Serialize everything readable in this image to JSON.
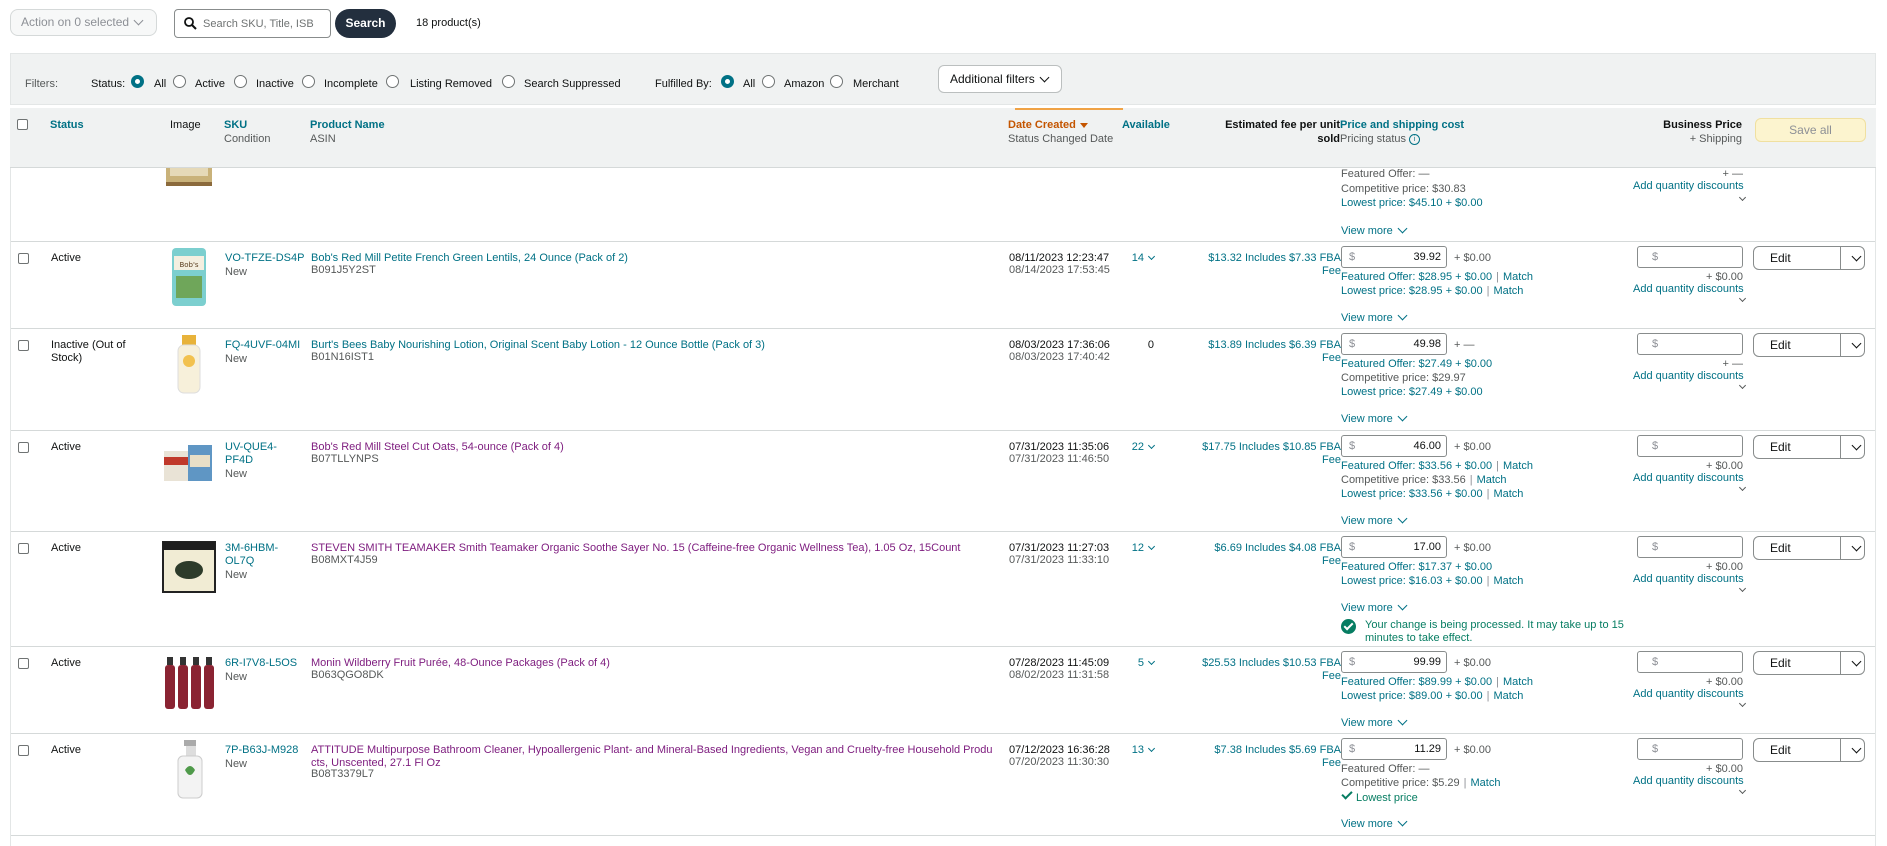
{
  "topbar": {
    "action_label": "Action on 0 selected",
    "search_placeholder": "Search SKU, Title, ISB",
    "search_button": "Search",
    "product_count": "18 product(s)"
  },
  "filters": {
    "label": "Filters:",
    "status_label": "Status:",
    "status_options": [
      "All",
      "Active",
      "Inactive",
      "Incomplete",
      "Listing Removed",
      "Search Suppressed"
    ],
    "status_selected": "All",
    "fulfilled_label": "Fulfilled By:",
    "fulfilled_options": [
      "All",
      "Amazon",
      "Merchant"
    ],
    "fulfilled_selected": "All",
    "additional_filters": "Additional filters"
  },
  "columns": {
    "status": "Status",
    "image": "Image",
    "sku": "SKU",
    "sku_sub": "Condition",
    "product_name": "Product Name",
    "product_sub": "ASIN",
    "date_created": "Date Created",
    "date_sub": "Status Changed Date",
    "available": "Available",
    "fee_line1": "Estimated fee per unit",
    "fee_line2": "sold",
    "price": "Price and shipping cost",
    "price_sub": "Pricing status",
    "business": "Business Price",
    "business_sub": "+ Shipping",
    "save_all": "Save all"
  },
  "partial_row": {
    "offer_featured": "Featured Offer: —",
    "competitive": "Competitive price: $30.83",
    "lowest": "Lowest price: $45.10 + $0.00",
    "view_more": "View more",
    "biz_ship": "+ —",
    "qty_discounts": "Add quantity discounts"
  },
  "rows": [
    {
      "status": "Active",
      "sku": "VO-TFZE-DS4P",
      "condition": "New",
      "name": "Bob's Red Mill Petite French Green Lentils, 24 Ounce (Pack of 2)",
      "asin": "B091J5Y2ST",
      "created": "08/11/2023 12:23:47",
      "changed": "08/14/2023 17:53:45",
      "available": "14",
      "fee1": "$13.32 Includes $7.33 FBA",
      "fee2": "Fee",
      "price": "39.92",
      "ship": "+ $0.00",
      "biz_ship": "+ $0.00",
      "qty": "Add quantity discounts",
      "edit": "Edit",
      "view_more": "View more",
      "featured": "Featured Offer: $28.95 + $0.00",
      "featured_match": "Match",
      "competitive": "",
      "lowest": "Lowest price: $28.95 + $0.00",
      "lowest_match": "Match"
    },
    {
      "status": "Inactive (Out of Stock)",
      "sku": "FQ-4UVF-04MI",
      "condition": "New",
      "name": "Burt's Bees Baby Nourishing Lotion, Original Scent Baby Lotion - 12 Ounce Bottle (Pack of 3)",
      "asin": "B01N16IST1",
      "created": "08/03/2023 17:36:06",
      "changed": "08/03/2023 17:40:42",
      "available": "0",
      "fee1": "$13.89 Includes $6.39 FBA",
      "fee2": "Fee",
      "price": "49.98",
      "ship": "+ —",
      "biz_ship": "+ —",
      "qty": "Add quantity discounts",
      "edit": "Edit",
      "view_more": "View more",
      "featured": "Featured Offer: $27.49 + $0.00",
      "featured_match": "",
      "competitive": "Competitive price: $29.97",
      "lowest": "Lowest price: $27.49 + $0.00",
      "lowest_match": ""
    },
    {
      "status": "Active",
      "sku": "UV-QUE4-PF4D",
      "condition": "New",
      "name": "Bob's Red Mill Steel Cut Oats, 54-ounce (Pack of 4)",
      "asin": "B07TLLYNPS",
      "created": "07/31/2023 11:35:06",
      "changed": "07/31/2023 11:46:50",
      "available": "22",
      "fee1": "$17.75 Includes $10.85 FBA",
      "fee2": "Fee",
      "price": "46.00",
      "ship": "+ $0.00",
      "biz_ship": "+ $0.00",
      "qty": "Add quantity discounts",
      "edit": "Edit",
      "view_more": "View more",
      "featured": "Featured Offer: $33.56 + $0.00",
      "featured_match": "Match",
      "competitive": "Competitive price: $33.56",
      "competitive_match": "Match",
      "lowest": "Lowest price: $33.56 + $0.00",
      "lowest_match": "Match"
    },
    {
      "status": "Active",
      "sku": "3M-6HBM-OL7Q",
      "condition": "New",
      "name": "STEVEN SMITH TEAMAKER Smith Teamaker Organic Soothe Sayer No. 15 (Caffeine-free Organic Wellness Tea), 1.05 Oz, 15Count",
      "asin": "B08MXT4J59",
      "created": "07/31/2023 11:27:03",
      "changed": "07/31/2023 11:33:10",
      "available": "12",
      "fee1": "$6.69 Includes $4.08 FBA",
      "fee2": "Fee",
      "price": "17.00",
      "ship": "+ $0.00",
      "biz_ship": "+ $0.00",
      "qty": "Add quantity discounts",
      "edit": "Edit",
      "view_more": "View more",
      "featured": "Featured Offer: $17.37 + $0.00",
      "featured_match": "",
      "competitive": "",
      "lowest": "Lowest price: $16.03 + $0.00",
      "lowest_match": "Match",
      "notice": "Your change is being processed. It may take up to 15 minutes to take effect."
    },
    {
      "status": "Active",
      "sku": "6R-I7V8-L5OS",
      "condition": "New",
      "name": "Monin Wildberry Fruit Purée, 48-Ounce Packages (Pack of 4)",
      "asin": "B063QGO8DK",
      "created": "07/28/2023 11:45:09",
      "changed": "08/02/2023 11:31:58",
      "available": "5",
      "fee1": "$25.53 Includes $10.53 FBA",
      "fee2": "Fee",
      "price": "99.99",
      "ship": "+ $0.00",
      "biz_ship": "+ $0.00",
      "qty": "Add quantity discounts",
      "edit": "Edit",
      "view_more": "View more",
      "featured": "Featured Offer: $89.99 + $0.00",
      "featured_match": "Match",
      "competitive": "",
      "lowest": "Lowest price: $89.00 + $0.00",
      "lowest_match": "Match"
    },
    {
      "status": "Active",
      "sku": "7P-B63J-M928",
      "condition": "New",
      "name": "ATTITUDE Multipurpose Bathroom Cleaner, Hypoallergenic Plant- and Mineral-Based Ingredients, Vegan and Cruelty-free Household Produ cts, Unscented, 27.1 Fl Oz",
      "asin": "B08T3379L7",
      "created": "07/12/2023 16:36:28",
      "changed": "07/20/2023 11:30:30",
      "available": "13",
      "fee1": "$7.38 Includes $5.69 FBA",
      "fee2": "Fee",
      "price": "11.29",
      "ship": "+ $0.00",
      "biz_ship": "+ $0.00",
      "qty": "Add quantity discounts",
      "edit": "Edit",
      "view_more": "View more",
      "featured": "Featured Offer: —",
      "featured_match": "",
      "competitive": "Competitive price: $5.29",
      "competitive_match": "Match",
      "lowest": "Lowest price",
      "lowest_match": ""
    }
  ],
  "colors": {
    "teal": "#007185",
    "purple": "#7d1b7e",
    "navy": "#232f3e",
    "orange": "#c45500",
    "green": "#067d62"
  }
}
